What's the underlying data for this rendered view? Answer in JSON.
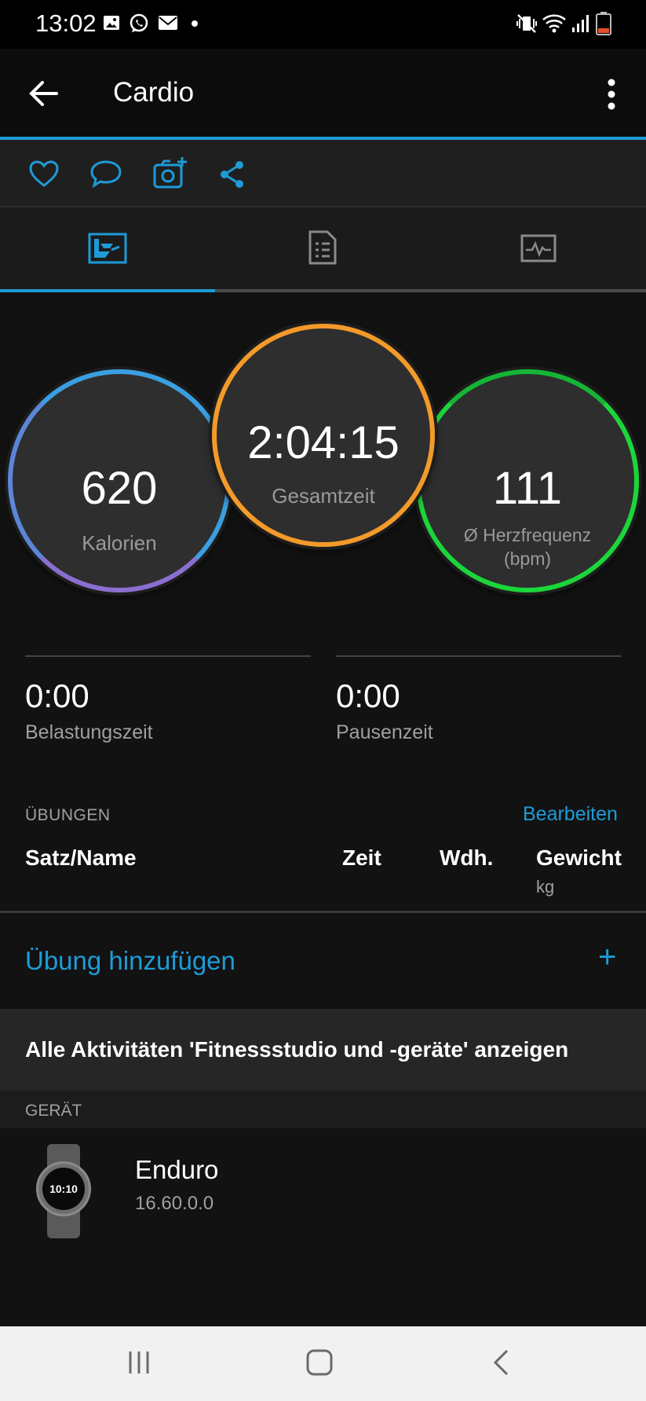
{
  "status_bar": {
    "time": "13:02"
  },
  "app_bar": {
    "title": "Cardio"
  },
  "colors": {
    "accent": "#1e9bd7",
    "calories_ring_top": "#3a9fe0",
    "calories_ring_bottom": "#8a6fd0",
    "time_ring": "#f39a2a",
    "hr_ring": "#1bd63a"
  },
  "tabs": [
    {
      "icon": "summary-chart-icon",
      "active": true
    },
    {
      "icon": "details-list-icon",
      "active": false
    },
    {
      "icon": "graph-chart-icon",
      "active": false
    }
  ],
  "summary": {
    "calories": {
      "value": "620",
      "label": "Kalorien"
    },
    "total_time": {
      "value": "2:04:15",
      "label": "Gesamtzeit"
    },
    "heart_rate": {
      "value": "111",
      "label_line1": "Ø Herzfrequenz",
      "label_line2": "(bpm)"
    }
  },
  "stats": {
    "work_time": {
      "value": "0:00",
      "label": "Belastungszeit"
    },
    "rest_time": {
      "value": "0:00",
      "label": "Pausenzeit"
    }
  },
  "exercises": {
    "section_label": "ÜBUNGEN",
    "edit_label": "Bearbeiten",
    "columns": {
      "set_name": "Satz/Name",
      "time": "Zeit",
      "reps": "Wdh.",
      "weight": "Gewicht",
      "weight_unit": "kg"
    },
    "add_label": "Übung hinzufügen",
    "add_icon": "+"
  },
  "all_activities_label": "Alle Aktivitäten 'Fitnessstudio und -geräte' anzeigen",
  "device": {
    "section_label": "GERÄT",
    "name": "Enduro",
    "version": "16.60.0.0",
    "watch_face_time": "10:10"
  }
}
